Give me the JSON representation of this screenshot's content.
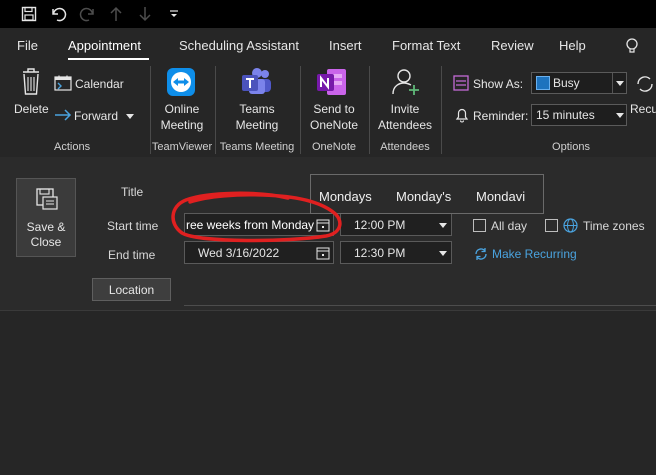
{
  "quick_access": {
    "icons": [
      "save-icon",
      "undo-icon",
      "redo-icon",
      "up-arrow-icon",
      "down-arrow-icon",
      "customize-toolbar-icon"
    ]
  },
  "tabs": [
    {
      "label": "File",
      "active": false
    },
    {
      "label": "Appointment",
      "active": true
    },
    {
      "label": "Scheduling Assistant",
      "active": false
    },
    {
      "label": "Insert",
      "active": false
    },
    {
      "label": "Format Text",
      "active": false
    },
    {
      "label": "Review",
      "active": false
    },
    {
      "label": "Help",
      "active": false
    }
  ],
  "ribbon": {
    "actions": {
      "delete_label": "Delete",
      "calendar_label": "Calendar",
      "forward_label": "Forward",
      "group_label": "Actions"
    },
    "teamviewer": {
      "online_meeting_line1": "Online",
      "online_meeting_line2": "Meeting",
      "group_label": "TeamViewer"
    },
    "teams_meeting": {
      "line1": "Teams",
      "line2": "Meeting",
      "group_label": "Teams Meeting"
    },
    "onenote": {
      "line1": "Send to",
      "line2": "OneNote",
      "group_label": "OneNote"
    },
    "attendees": {
      "line1": "Invite",
      "line2": "Attendees",
      "group_label": "Attendees"
    },
    "options": {
      "show_as_label": "Show As:",
      "show_as_value": "Busy",
      "show_as_color": "#1e73be",
      "reminder_label": "Reminder:",
      "reminder_value": "15 minutes",
      "group_label": "Options",
      "recurrence_partial": "Recu"
    }
  },
  "form": {
    "save_close_line1": "Save &",
    "save_close_line2": "Close",
    "title_label": "Title",
    "start_time_label": "Start time",
    "end_time_label": "End time",
    "start_date_value": "ree weeks from Monday",
    "start_time_value": "12:00 PM",
    "end_date_value": "Wed 3/16/2022",
    "end_time_value": "12:30 PM",
    "all_day_label": "All day",
    "time_zones_label": "Time zones",
    "make_recurring_label": "Make Recurring",
    "location_label": "Location",
    "link_color": "#4aa3df"
  },
  "autocomplete": {
    "items": [
      "Mondays",
      "Monday's",
      "Mondavi"
    ]
  },
  "annotation_color": "#e02020"
}
